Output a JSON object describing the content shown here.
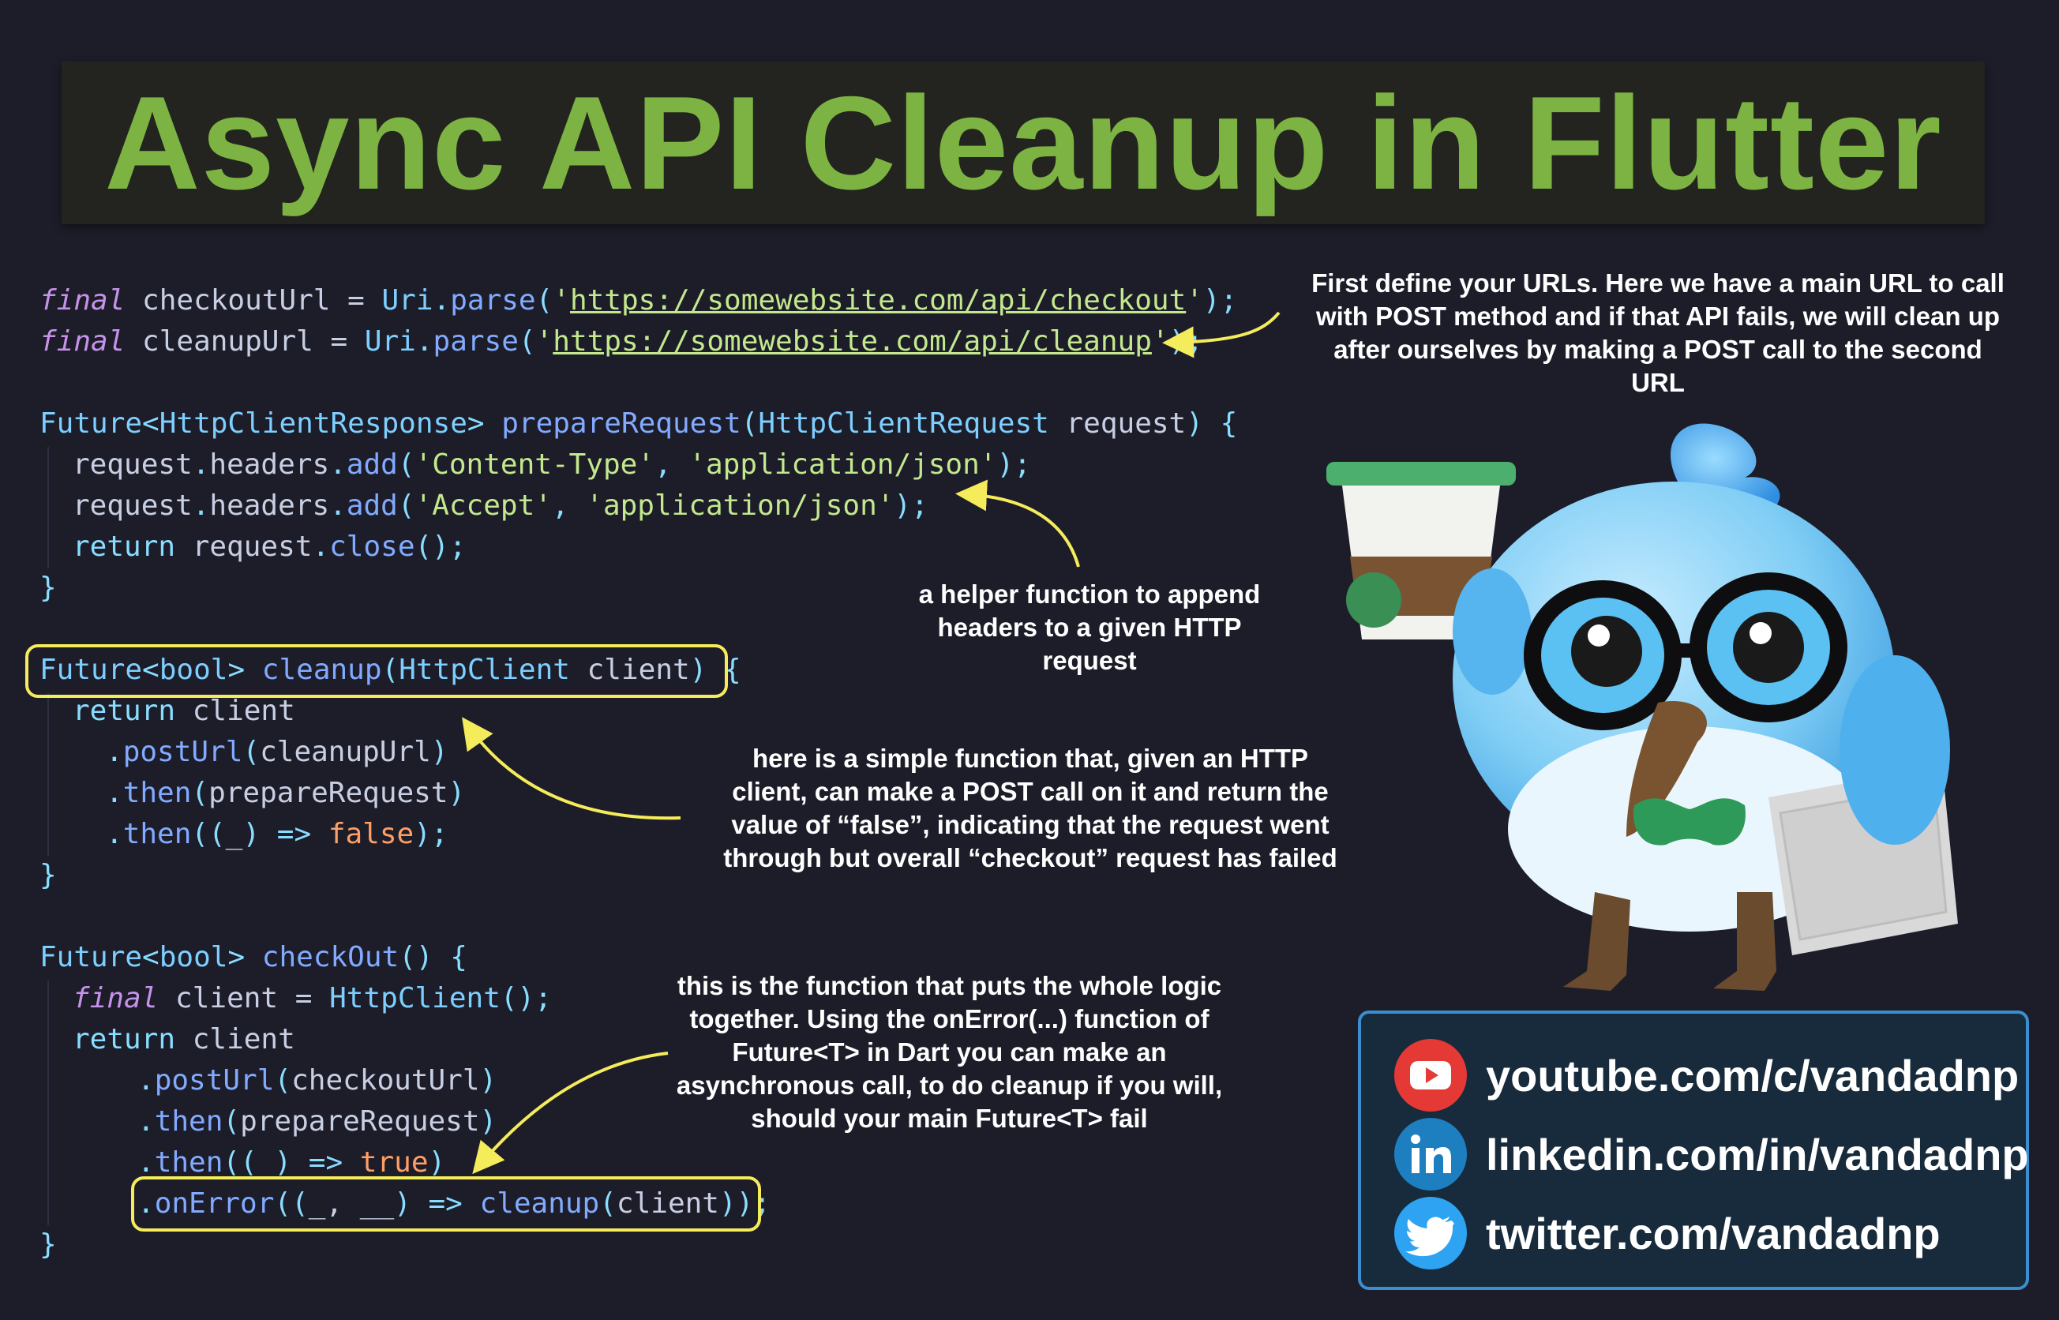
{
  "title": "Async API Cleanup in Flutter",
  "code": {
    "l1": {
      "kw": "final",
      "name": " checkoutUrl = ",
      "type": "Uri",
      "dot": ".",
      "fn": "parse",
      "open": "(",
      "q1": "'",
      "url": "https://somewebsite.com/api/checkout",
      "q2": "'",
      "close": ");"
    },
    "l2": {
      "kw": "final",
      "name": " cleanupUrl = ",
      "type": "Uri",
      "dot": ".",
      "fn": "parse",
      "open": "(",
      "q1": "'",
      "url": "https://somewebsite.com/api/cleanup",
      "q2": "'",
      "close": ");"
    },
    "l3": {
      "t1": "Future",
      "lt": "<",
      "t2": "HttpClientResponse",
      "gt": ">",
      "fn": " prepareRequest",
      "open": "(",
      "t3": "HttpClientRequest",
      "param": " request",
      "close": ") {"
    },
    "l4": {
      "obj": "request",
      "dot1": ".",
      "prop": "headers",
      "dot2": ".",
      "fn": "add",
      "open": "(",
      "s1": "'Content-Type'",
      "comma": ", ",
      "s2": "'application/json'",
      "close": ");"
    },
    "l5": {
      "obj": "request",
      "dot1": ".",
      "prop": "headers",
      "dot2": ".",
      "fn": "add",
      "open": "(",
      "s1": "'Accept'",
      "comma": ", ",
      "s2": "'application/json'",
      "close": ");"
    },
    "l6": {
      "ret": "return",
      "obj": " request",
      "dot": ".",
      "fn": "close",
      "close": "();"
    },
    "l7": {
      "brace": "}"
    },
    "l8": {
      "t1": "Future",
      "lt": "<",
      "t2": "bool",
      "gt": ">",
      "fn": " cleanup",
      "open": "(",
      "t3": "HttpClient",
      "param": " client",
      "close": ") {"
    },
    "l9": {
      "ret": "return",
      "obj": " client"
    },
    "l10": {
      "dot": ".",
      "fn": "postUrl",
      "open": "(",
      "arg": "cleanupUrl",
      "close": ")"
    },
    "l11": {
      "dot": ".",
      "fn": "then",
      "open": "(",
      "arg": "prepareRequest",
      "close": ")"
    },
    "l12": {
      "dot": ".",
      "fn": "then",
      "open": "((",
      "arg": "_",
      "arrow": ") => ",
      "val": "false",
      "close": ");"
    },
    "l13": {
      "brace": "}"
    },
    "l14": {
      "t1": "Future",
      "lt": "<",
      "t2": "bool",
      "gt": ">",
      "fn": " checkOut",
      "close": "() {"
    },
    "l15": {
      "kw": "final",
      "name": " client = ",
      "type": "HttpClient",
      "close": "();"
    },
    "l16": {
      "ret": "return",
      "obj": " client"
    },
    "l17": {
      "dot": ".",
      "fn": "postUrl",
      "open": "(",
      "arg": "checkoutUrl",
      "close": ")"
    },
    "l18": {
      "dot": ".",
      "fn": "then",
      "open": "(",
      "arg": "prepareRequest",
      "close": ")"
    },
    "l19": {
      "dot": ".",
      "fn": "then",
      "open": "((",
      "arg": "_",
      "arrow": ") => ",
      "val": "true",
      "close": ")"
    },
    "l20": {
      "dot": ".",
      "fn": "onError",
      "open": "((",
      "arg": "_, __",
      "arrow": ") => ",
      "fn2": "cleanup",
      "open2": "(",
      "arg2": "client",
      "close": "));"
    },
    "l21": {
      "brace": "}"
    }
  },
  "notes": {
    "urls": [
      "First define your URLs. Here we have a main URL to call",
      "with POST method and if that API fails, we will clean up",
      "after ourselves by making a POST call to the second",
      "URL"
    ],
    "helper": [
      "a helper function to append",
      "headers to a given HTTP",
      "request"
    ],
    "cleanup": [
      "here is a simple function that, given an HTTP",
      "client, can make a POST call on it and return the",
      "value of “false”, indicating that the request went",
      "through but overall “checkout” request has failed"
    ],
    "checkout": [
      "this is the function that puts the whole logic",
      "together. Using the onError(...) function of",
      "Future<T> in Dart you can make an",
      "asynchronous call, to do cleanup if you will,",
      "should your main Future<T> fail"
    ]
  },
  "social": [
    {
      "icon": "youtube-icon",
      "text": "youtube.com/c/vandadnp"
    },
    {
      "icon": "linkedin-icon",
      "text": "linkedin.com/in/vandadnp"
    },
    {
      "icon": "twitter-icon",
      "text": "twitter.com/vandadnp"
    }
  ],
  "colors": {
    "title": "#7cb342",
    "highlight": "#f5ec5b",
    "background": "#1d1d2a"
  }
}
